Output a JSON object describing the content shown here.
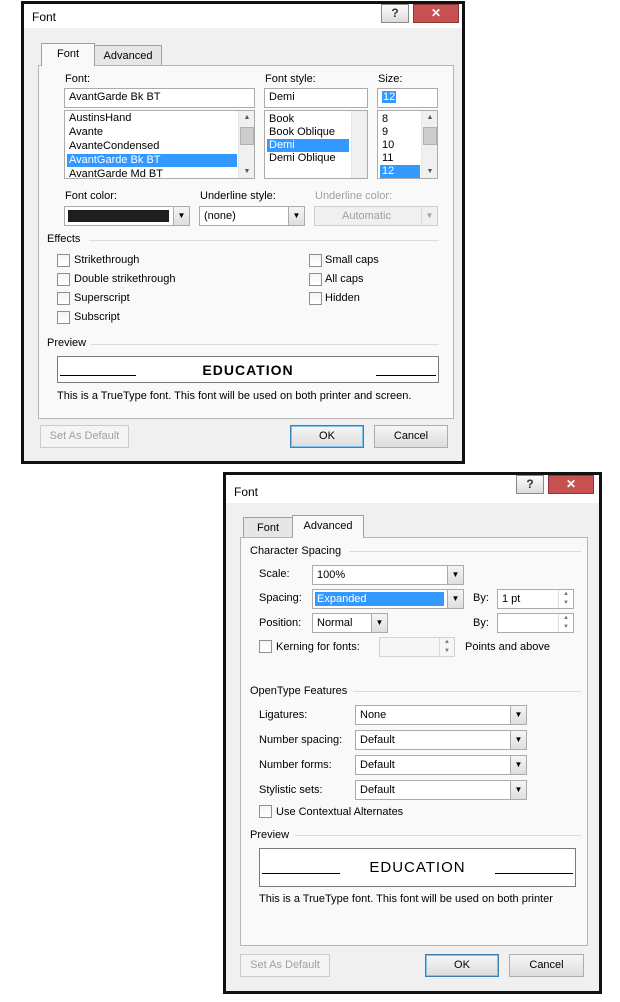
{
  "dialog1": {
    "title": "Font",
    "help_button": "?",
    "close_button": "✕",
    "tabs": [
      "Font",
      "Advanced"
    ],
    "font_label": "Font:",
    "font_value": "AvantGarde Bk BT",
    "font_list": [
      "AustinsHand",
      "Avante",
      "AvanteCondensed",
      "AvantGarde Bk BT",
      "AvantGarde Md BT"
    ],
    "font_selected_index": 3,
    "style_label": "Font style:",
    "style_value": "Demi",
    "style_list": [
      "Book",
      "Book Oblique",
      "Demi",
      "Demi Oblique"
    ],
    "style_selected_index": 2,
    "size_label": "Size:",
    "size_value": "12",
    "size_list": [
      "8",
      "9",
      "10",
      "11",
      "12"
    ],
    "size_selected_index": 4,
    "font_color_label": "Font color:",
    "font_color": "#1e1e1e",
    "underline_style_label": "Underline style:",
    "underline_style_value": "(none)",
    "underline_color_label": "Underline color:",
    "underline_color_value": "Automatic",
    "effects_label": "Effects",
    "effects_left": [
      "Strikethrough",
      "Double strikethrough",
      "Superscript",
      "Subscript"
    ],
    "effects_right": [
      "Small caps",
      "All caps",
      "Hidden"
    ],
    "preview_label": "Preview",
    "preview_text": "EDUCATION",
    "preview_note": "This is a TrueType font. This font will be used on both printer and screen.",
    "set_default": "Set As Default",
    "ok": "OK",
    "cancel": "Cancel"
  },
  "dialog2": {
    "title": "Font",
    "help_button": "?",
    "close_button": "✕",
    "tabs": [
      "Font",
      "Advanced"
    ],
    "character_spacing_label": "Character Spacing",
    "scale_label": "Scale:",
    "scale_value": "100%",
    "spacing_label": "Spacing:",
    "spacing_value": "Expanded",
    "spacing_by_label": "By:",
    "spacing_by_value": "1 pt",
    "position_label": "Position:",
    "position_value": "Normal",
    "position_by_label": "By:",
    "position_by_value": "",
    "kerning_label": "Kerning for fonts:",
    "kerning_value": "",
    "points_label": "Points and above",
    "opentype_label": "OpenType Features",
    "ligatures_label": "Ligatures:",
    "ligatures_value": "None",
    "number_spacing_label": "Number spacing:",
    "number_spacing_value": "Default",
    "number_forms_label": "Number forms:",
    "number_forms_value": "Default",
    "stylistic_sets_label": "Stylistic sets:",
    "stylistic_sets_value": "Default",
    "contextual_label": "Use Contextual Alternates",
    "preview_label": "Preview",
    "preview_text": "EDUCATION",
    "preview_note": "This is a TrueType font. This font will be used on both printer",
    "set_default": "Set As Default",
    "ok": "OK",
    "cancel": "Cancel"
  }
}
